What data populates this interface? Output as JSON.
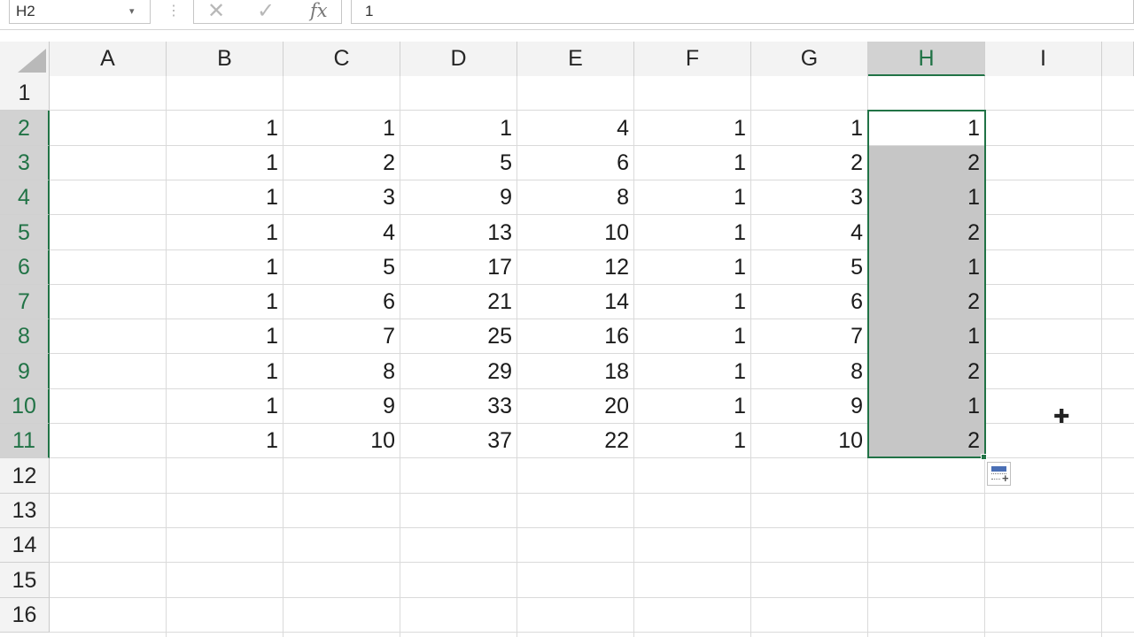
{
  "formula_bar": {
    "name_box": "H2",
    "name_box_arrow": "▾",
    "dots": "⋮",
    "cancel_glyph": "✕",
    "enter_glyph": "✓",
    "fx_label": "fx",
    "formula": "1"
  },
  "columns": [
    "A",
    "B",
    "C",
    "D",
    "E",
    "F",
    "G",
    "H",
    "I"
  ],
  "selected_column": "H",
  "rows": [
    "1",
    "2",
    "3",
    "4",
    "5",
    "6",
    "7",
    "8",
    "9",
    "10",
    "11",
    "12",
    "13",
    "14",
    "15",
    "16"
  ],
  "selected_rows": [
    "2",
    "3",
    "4",
    "5",
    "6",
    "7",
    "8",
    "9",
    "10",
    "11"
  ],
  "cells": {
    "B": [
      "1",
      "1",
      "1",
      "1",
      "1",
      "1",
      "1",
      "1",
      "1",
      "1"
    ],
    "C": [
      "1",
      "2",
      "3",
      "4",
      "5",
      "6",
      "7",
      "8",
      "9",
      "10"
    ],
    "D": [
      "1",
      "5",
      "9",
      "13",
      "17",
      "21",
      "25",
      "29",
      "33",
      "37"
    ],
    "E": [
      "4",
      "6",
      "8",
      "10",
      "12",
      "14",
      "16",
      "18",
      "20",
      "22"
    ],
    "F": [
      "1",
      "1",
      "1",
      "1",
      "1",
      "1",
      "1",
      "1",
      "1",
      "1"
    ],
    "G": [
      "1",
      "2",
      "3",
      "4",
      "5",
      "6",
      "7",
      "8",
      "9",
      "10"
    ],
    "H": [
      "1",
      "2",
      "1",
      "2",
      "1",
      "2",
      "1",
      "2",
      "1",
      "2"
    ]
  },
  "data_first_row": 2,
  "selection": {
    "range": "H2:H11",
    "active_cell": "H2"
  },
  "colors": {
    "accent": "#217346",
    "selection_fill": "#c6c6c6",
    "header_bg": "#f3f3f3"
  },
  "icons": {
    "quick_analysis": "quick-analysis-icon",
    "cursor": "cell-cursor-icon"
  },
  "cursor_glyph": "✚"
}
